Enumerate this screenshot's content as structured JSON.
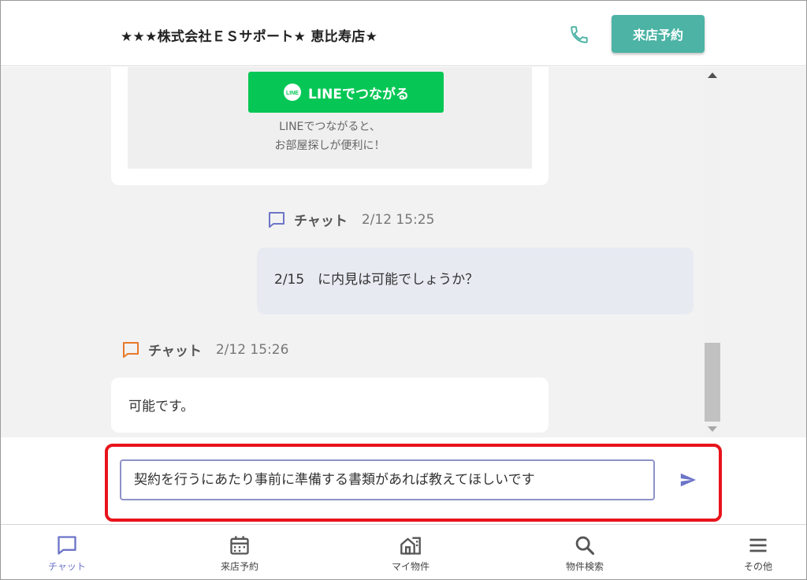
{
  "header": {
    "store_title": "★★★株式会社ＥＳサポート★ 恵比寿店★",
    "reserve_button": "来店予約",
    "phone_icon": "phone-icon"
  },
  "chat": {
    "line_card": {
      "button_label": "LINEでつながる",
      "desc_line1": "LINEでつながると、",
      "desc_line2": "お部屋探しが便利に！",
      "line_color": "#06c755"
    },
    "messages": [
      {
        "sender": "チャット",
        "time": "2/12 15:25",
        "text": "2/15　に内見は可能でしょうか？",
        "icon": "chat-bubble-icon",
        "icon_color": "#6d75c8"
      },
      {
        "sender": "チャット",
        "time": "2/12 15:26",
        "text": "可能です。",
        "icon": "chat-bubble-icon",
        "icon_color": "#e8782a"
      }
    ]
  },
  "input": {
    "value": "契約を行うにあたり事前に準備する書類があれば教えてほしいです",
    "send_icon": "send-icon",
    "highlight_color": "#e8141b"
  },
  "nav": {
    "items": [
      {
        "label": "チャット",
        "icon": "chat-icon",
        "active": true
      },
      {
        "label": "来店予約",
        "icon": "calendar-icon",
        "active": false
      },
      {
        "label": "マイ物件",
        "icon": "house-icon",
        "active": false
      },
      {
        "label": "物件検索",
        "icon": "search-icon",
        "active": false
      },
      {
        "label": "その他",
        "icon": "menu-icon",
        "active": false
      }
    ]
  },
  "colors": {
    "accent": "#4cb3a5",
    "active_nav": "#6d75c8"
  }
}
